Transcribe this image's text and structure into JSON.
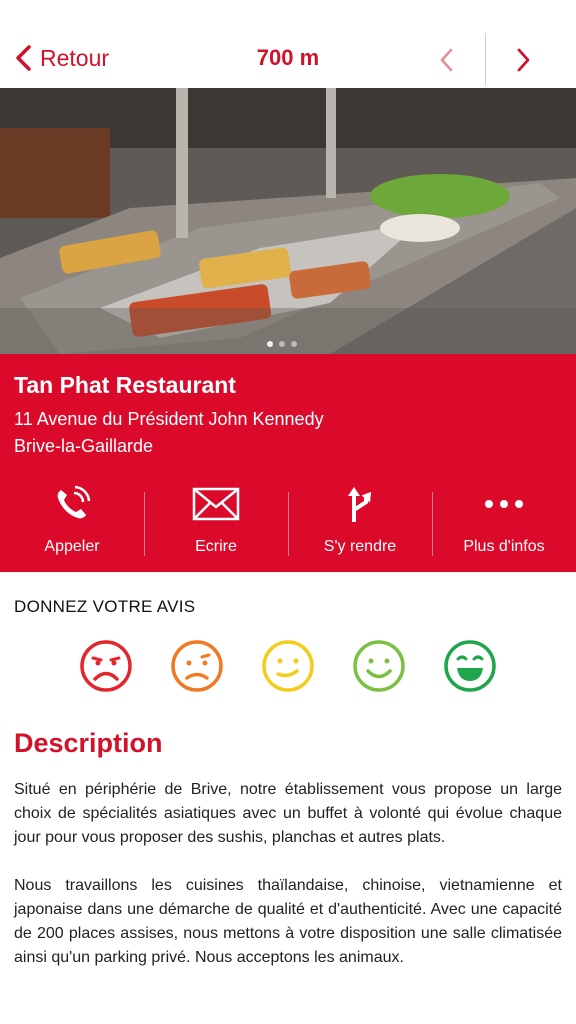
{
  "header": {
    "back_label": "Retour",
    "distance": "700 m"
  },
  "restaurant": {
    "name": "Tan Phat Restaurant",
    "address_line1": "11  Avenue du Président John Kennedy",
    "address_line2": "Brive-la-Gaillarde"
  },
  "actions": [
    {
      "label": "Appeler",
      "icon": "phone-icon"
    },
    {
      "label": "Ecrire",
      "icon": "envelope-icon"
    },
    {
      "label": "S'y rendre",
      "icon": "directions-icon"
    },
    {
      "label": "Plus d'infos",
      "icon": "more-dots-icon"
    }
  ],
  "rating": {
    "title": "DONNEZ VOTRE AVIS",
    "faces": [
      {
        "name": "very-unhappy",
        "color": "#e3262c"
      },
      {
        "name": "unhappy",
        "color": "#ef7a23"
      },
      {
        "name": "neutral",
        "color": "#f4cc1a"
      },
      {
        "name": "happy",
        "color": "#7ac142"
      },
      {
        "name": "very-happy",
        "color": "#1fa64b"
      }
    ]
  },
  "description": {
    "title": "Description",
    "paragraphs": [
      "Situé en périphérie de Brive, notre établissement vous propose un large choix de spécialités asiatiques avec un buffet à volonté qui évolue chaque jour pour vous proposer des sushis, planchas et autres plats.",
      "Nous travaillons les cuisines thaïlandaise, chinoise, vietnamienne et japonaise dans une démarche de qualité et d'authenticité. Avec une capacité de 200 places assises, nous mettons à votre disposition une salle climatisée ainsi qu'un parking privé. Nous acceptons les animaux."
    ]
  },
  "colors": {
    "accent": "#d0122a",
    "panel": "#db0a2a"
  }
}
